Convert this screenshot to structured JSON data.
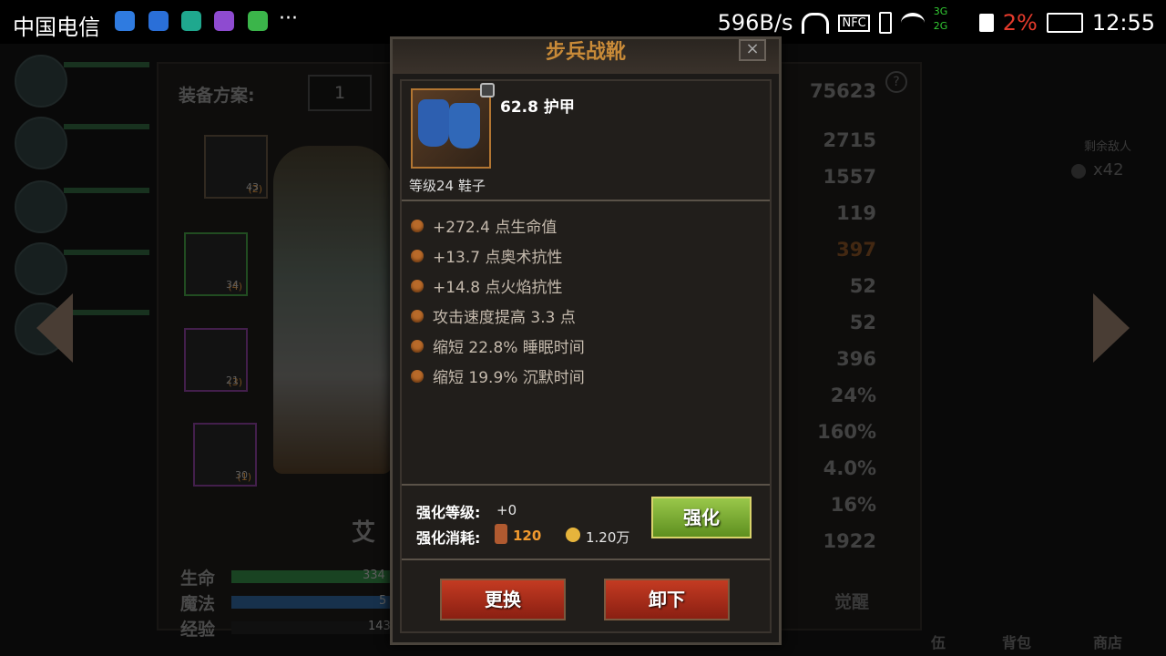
{
  "status_bar": {
    "carrier": "中国电信",
    "speed": "596B/s",
    "nfc": "NFC",
    "network_3g": "3G",
    "network_2g": "2G",
    "battery": "2%",
    "time": "12:55",
    "ellipsis": "···"
  },
  "background": {
    "equip_scheme_label": "装备方案:",
    "equip_scheme_value": "1",
    "hero_name_partial": "艾",
    "enemies_label": "剩余敌人",
    "enemies_count": "x42",
    "stats_left": [
      {
        "label": "生命",
        "value": "334"
      },
      {
        "label": "魔法",
        "value": "5"
      },
      {
        "label": "经验",
        "value": "143"
      }
    ],
    "stat_numbers": [
      "75623",
      "2715",
      "1557",
      "119",
      "397",
      "52",
      "52",
      "396",
      "24%",
      "160%",
      "4.0%",
      "16%",
      "1922"
    ],
    "awaken_label": "觉醒",
    "nav_items": [
      "伍",
      "背包",
      "商店"
    ],
    "slots": [
      {
        "count": "43",
        "bonus": "(2)"
      },
      {
        "count": "34",
        "bonus": "(4)"
      },
      {
        "count": "21",
        "bonus": "(3)"
      },
      {
        "count": "30",
        "bonus": "(1)"
      }
    ]
  },
  "popup": {
    "title": "步兵战靴",
    "close_symbol": "×",
    "armor": "62.8 护甲",
    "level": "等级24  鞋子",
    "stats": [
      "+272.4 点生命值",
      "+13.7 点奥术抗性",
      "+14.8 点火焰抗性",
      "攻击速度提高 3.3 点",
      "缩短 22.8% 睡眠时间",
      "缩短 19.9% 沉默时间"
    ],
    "enhance_level_label": "强化等级:",
    "enhance_level_value": "+0",
    "enhance_cost_label": "强化消耗:",
    "ore_cost": "120",
    "gold_cost": "1.20万",
    "enhance_button": "强化",
    "replace_button": "更换",
    "unequip_button": "卸下"
  },
  "colors": {
    "accent_orange": "#f29a2e",
    "title_gold": "#c88a38",
    "enhance_green": "#7aae2f",
    "button_red": "#a82c1a"
  }
}
